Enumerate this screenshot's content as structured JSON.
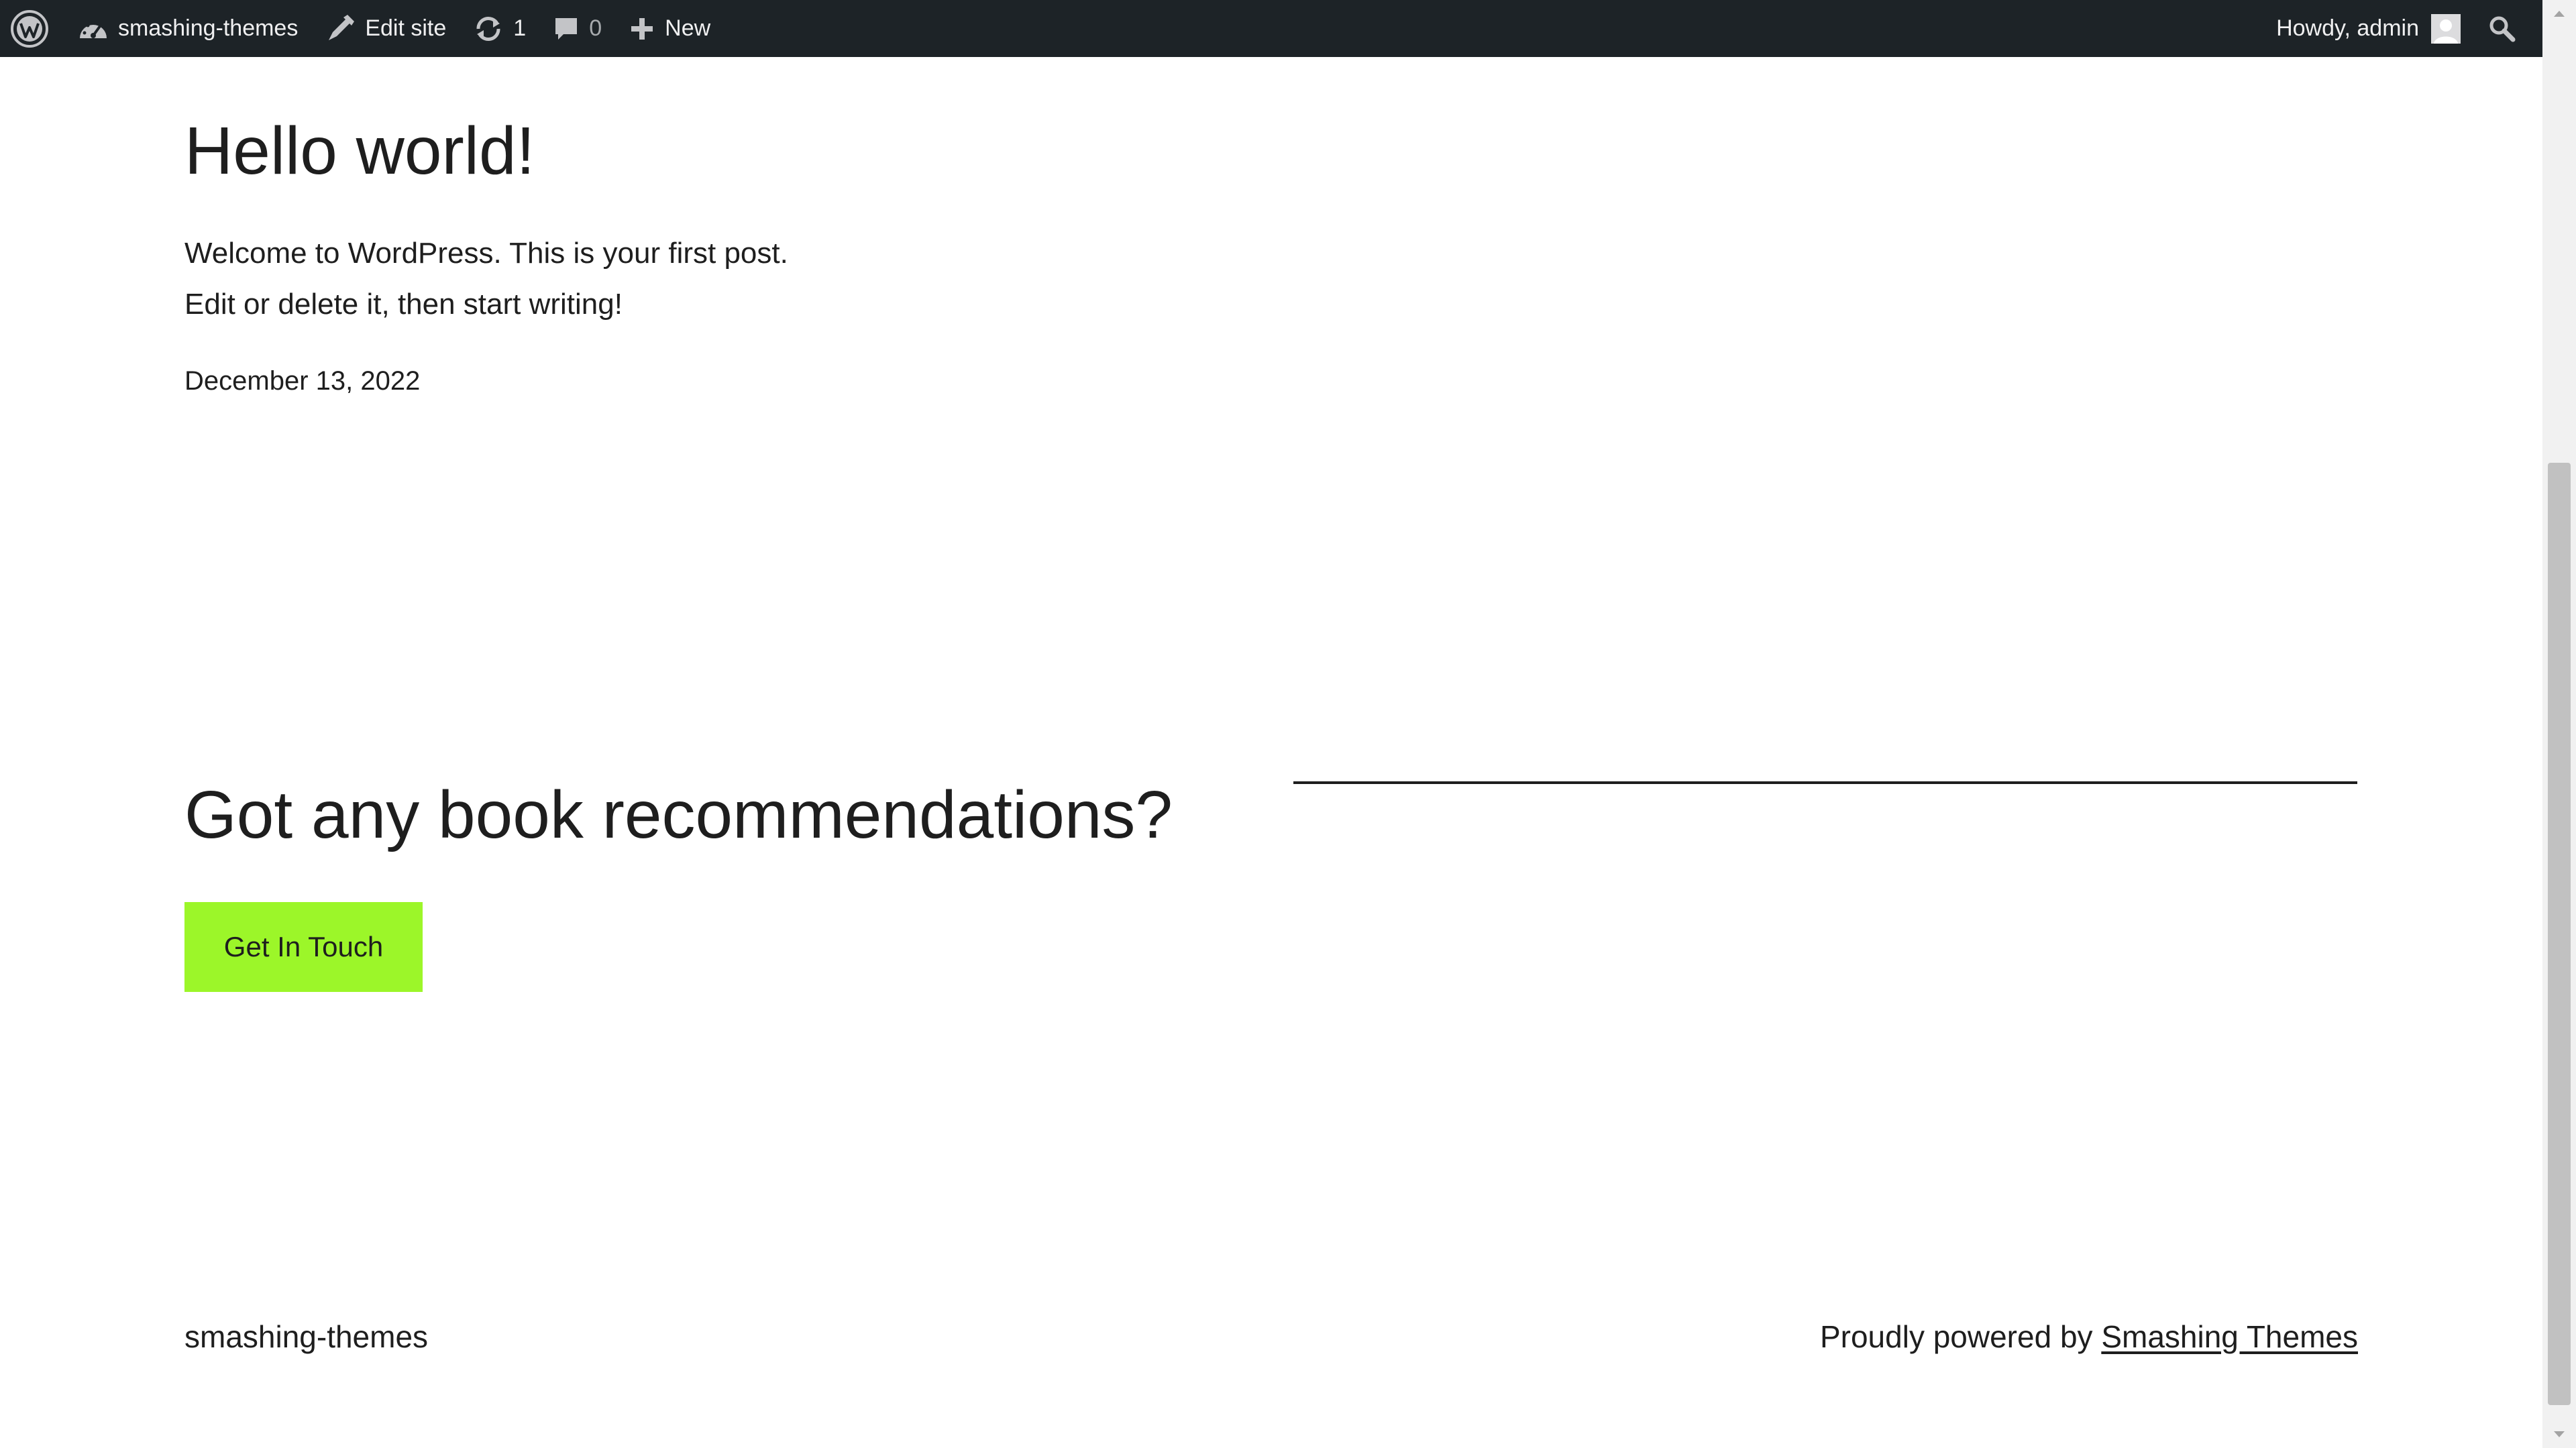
{
  "admin_bar": {
    "site_name": "smashing-themes",
    "edit_site_label": "Edit site",
    "updates_count": "1",
    "comments_count": "0",
    "new_label": "New",
    "howdy_label": "Howdy, admin",
    "icons": [
      "wordpress-logo-icon",
      "dashboard-icon",
      "edit-site-icon",
      "updates-icon",
      "comments-icon",
      "plus-icon",
      "avatar",
      "search-icon"
    ]
  },
  "post": {
    "title": "Hello world!",
    "body_line1": "Welcome to WordPress. This is your first post.",
    "body_line2": "Edit or delete it, then start writing!",
    "date": "December 13, 2022"
  },
  "cta": {
    "heading": "Got any book recommendations?",
    "button_label": "Get In Touch",
    "button_color": "#9cf629"
  },
  "footer": {
    "site_title": "smashing-themes",
    "powered_prefix": "Proudly powered by",
    "powered_link": "Smashing Themes"
  },
  "colors": {
    "admin_bar_bg": "#1d2327",
    "text": "#1e1e1e",
    "background": "#ffffff"
  }
}
